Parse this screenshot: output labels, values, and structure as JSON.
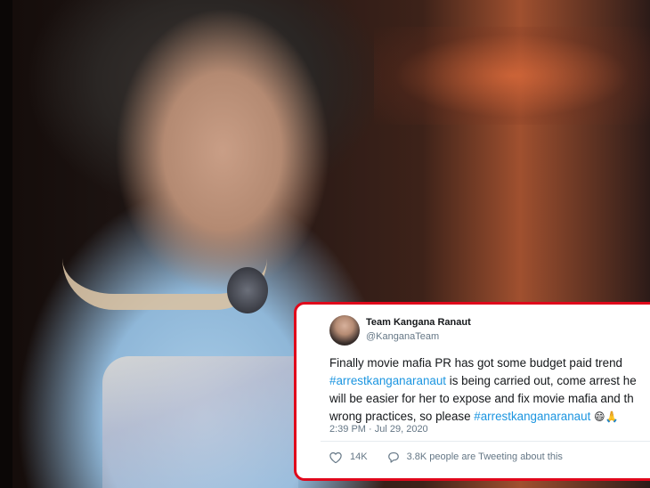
{
  "tweet": {
    "display_name": "Team Kangana Ranaut",
    "handle": "@KanganaTeam",
    "lines": [
      [
        {
          "text": "Finally movie mafia PR has got some budget paid trend",
          "hashtag": false
        }
      ],
      [
        {
          "text": "#arrestkanganaranaut",
          "hashtag": true
        },
        {
          "text": " is being carried out, come arrest he",
          "hashtag": false
        }
      ],
      [
        {
          "text": "will be easier for her to expose and fix movie mafia and th",
          "hashtag": false
        }
      ],
      [
        {
          "text": "wrong practices, so please ",
          "hashtag": false
        },
        {
          "text": "#arrestkanganaranaut",
          "hashtag": true
        }
      ]
    ],
    "emojis": [
      "😄",
      "🙏"
    ],
    "timestamp": "2:39 PM · Jul 29, 2020",
    "like_count": "14K",
    "people_tweeting": "3.8K people are Tweeting about this",
    "icons": {
      "like": "heart-icon",
      "people": "speech-bubble-icon"
    },
    "colors": {
      "hashtag": "#1b95e0",
      "border": "#e0071b",
      "meta": "#657786"
    }
  }
}
